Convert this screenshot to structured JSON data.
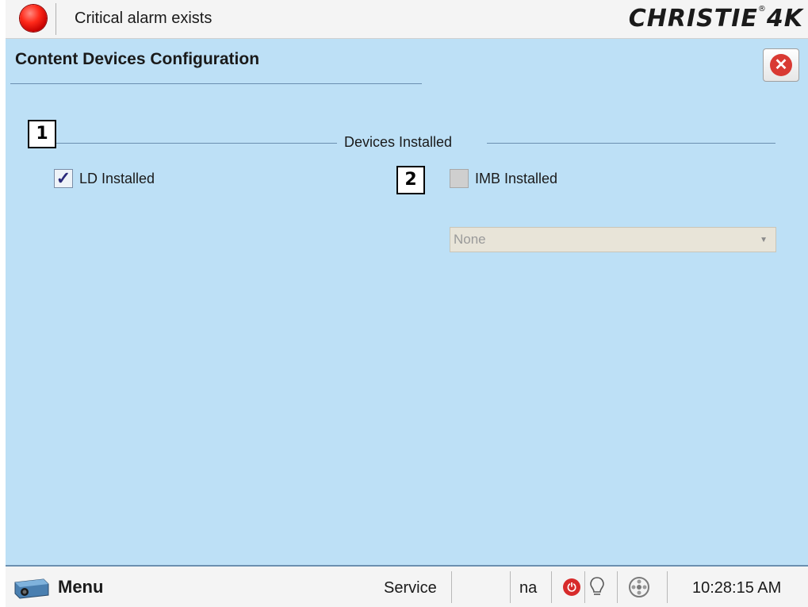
{
  "top_bar": {
    "alarm_text": "Critical alarm exists",
    "brand": "CHRISTIE",
    "brand_suffix": "4K",
    "brand_mark": "®"
  },
  "page": {
    "title": "Content Devices Configuration"
  },
  "callouts": [
    "1",
    "2"
  ],
  "group": {
    "label": "Devices Installed",
    "ld_checkbox": {
      "label": "LD Installed",
      "checked": true
    },
    "imb_checkbox": {
      "label": "IMB Installed",
      "checked": false
    },
    "imb_select": {
      "value": "None",
      "enabled": false
    }
  },
  "bottom_bar": {
    "menu_label": "Menu",
    "mode": "Service",
    "status_na": "na",
    "time": "10:28:15 AM"
  },
  "colors": {
    "panel_bg": "#bde0f6",
    "alarm_red": "#ff2a1a",
    "rule_blue": "#6b8fb0"
  },
  "icons": [
    "alarm-indicator-icon",
    "close-icon",
    "checkmark-icon",
    "chevron-down-icon",
    "projector-icon",
    "power-icon",
    "lamp-icon",
    "film-reel-icon"
  ]
}
